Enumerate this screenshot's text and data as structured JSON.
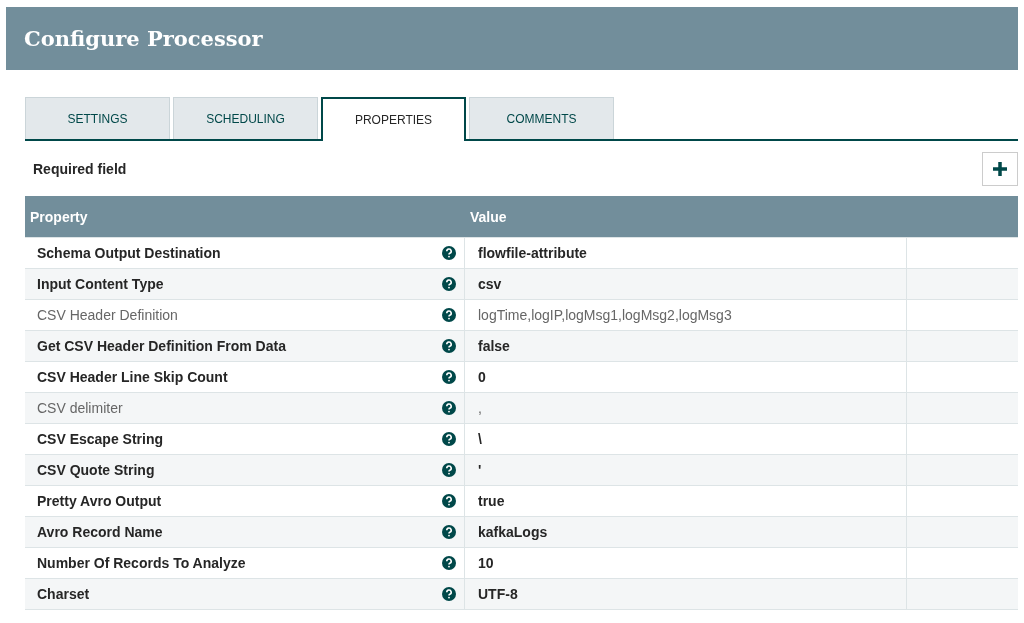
{
  "window": {
    "title": "Configure Processor"
  },
  "tabs": [
    {
      "label": "SETTINGS",
      "selected": false
    },
    {
      "label": "SCHEDULING",
      "selected": false
    },
    {
      "label": "PROPERTIES",
      "selected": true
    },
    {
      "label": "COMMENTS",
      "selected": false
    }
  ],
  "required_note": "Required field",
  "table": {
    "columns": [
      "Property",
      "Value"
    ],
    "rows": [
      {
        "property": "Schema Output Destination",
        "value": "flowfile-attribute",
        "required": true
      },
      {
        "property": "Input Content Type",
        "value": "csv",
        "required": true
      },
      {
        "property": "CSV Header Definition",
        "value": "logTime,logIP,logMsg1,logMsg2,logMsg3",
        "required": false
      },
      {
        "property": "Get CSV Header Definition From Data",
        "value": "false",
        "required": true
      },
      {
        "property": "CSV Header Line Skip Count",
        "value": "0",
        "required": true
      },
      {
        "property": "CSV delimiter",
        "value": ",",
        "required": false
      },
      {
        "property": "CSV Escape String",
        "value": "\\",
        "required": true
      },
      {
        "property": "CSV Quote String",
        "value": "'",
        "required": true
      },
      {
        "property": "Pretty Avro Output",
        "value": "true",
        "required": true
      },
      {
        "property": "Avro Record Name",
        "value": "kafkaLogs",
        "required": true
      },
      {
        "property": "Number Of Records To Analyze",
        "value": "10",
        "required": true
      },
      {
        "property": "Charset",
        "value": "UTF-8",
        "required": true
      }
    ]
  }
}
